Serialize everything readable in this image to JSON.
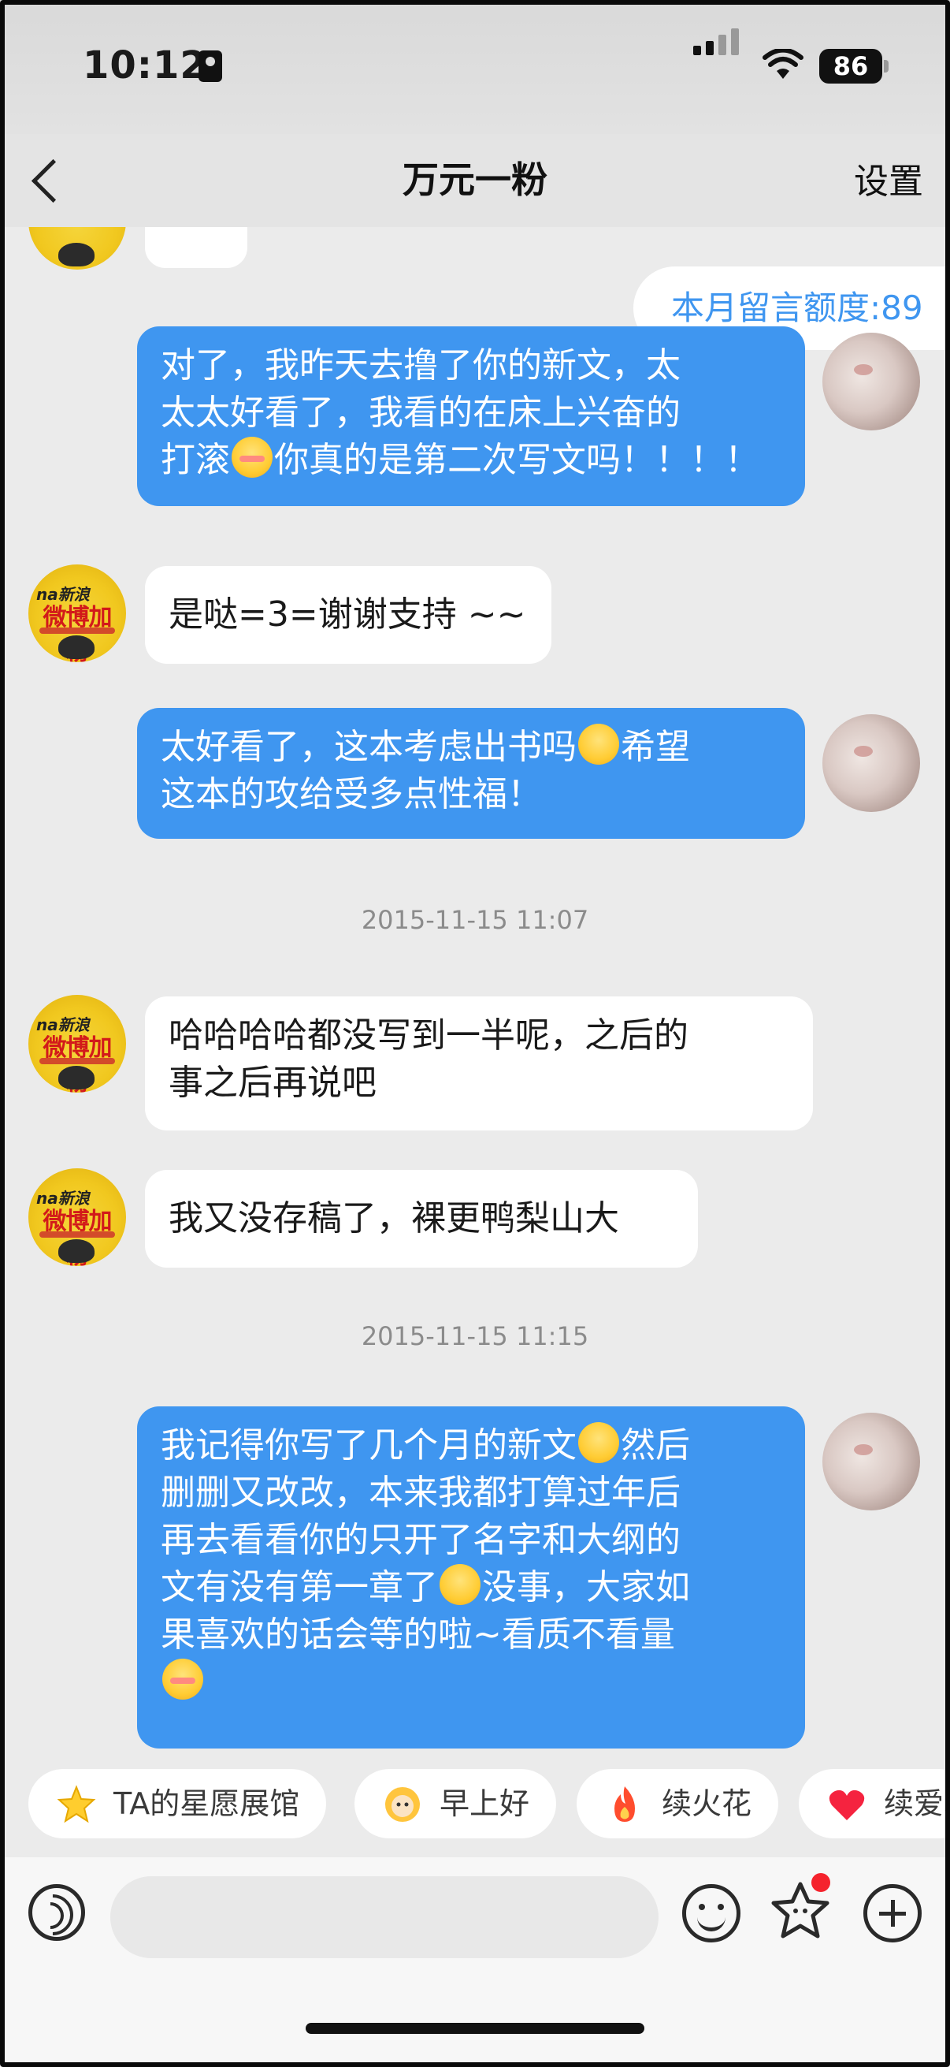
{
  "status_bar": {
    "time": "10:12",
    "battery": "86"
  },
  "nav": {
    "title": "万元一粉",
    "settings_label": "设置"
  },
  "quota_label": "本月留言额度:89",
  "messages": [
    {
      "side": "out",
      "lines": [
        "对了，我昨天去撸了你的新文，太",
        "太太好看了，我看的在床上兴奋的",
        "打滚",
        "你真的是第二次写文吗！！！！"
      ]
    },
    {
      "side": "in",
      "lines": [
        "是哒=3=谢谢支持 ~~"
      ]
    },
    {
      "side": "out",
      "lines": [
        "太好看了，这本考虑出书吗",
        "希望",
        "这本的攻给受多点性福！"
      ]
    },
    {
      "side": "in",
      "lines": [
        "哈哈哈哈都没写到一半呢，之后的",
        "事之后再说吧"
      ]
    },
    {
      "side": "in",
      "lines": [
        "我又没存稿了，裸更鸭梨山大"
      ]
    },
    {
      "side": "out",
      "lines": [
        "我记得你写了几个月的新文",
        "然后",
        "删删又改改，本来我都打算过年后",
        "再去看看你的只开了名字和大纲的",
        "文有没有第一章了",
        "没事，大家如",
        "果喜欢的话会等的啦~看质不看量"
      ]
    }
  ],
  "timestamps": [
    "2015-11-15 11:07",
    "2015-11-15 11:15"
  ],
  "avatar_left": {
    "top_text": "na新浪",
    "main_text": "微博加粉"
  },
  "chips": [
    "TA的星愿展馆",
    "早上好",
    "续火花",
    "续爱心"
  ],
  "input": {
    "placeholder": ""
  },
  "colors": {
    "out_bubble": "#3f96f0",
    "in_bubble": "#ffffff",
    "background": "#ebebeb"
  }
}
